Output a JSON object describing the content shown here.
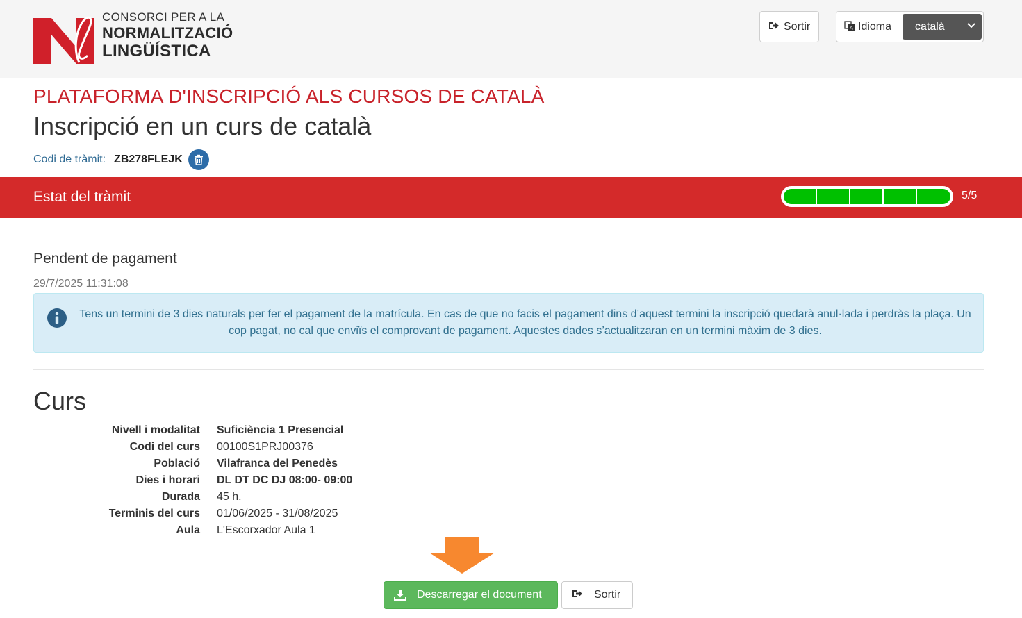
{
  "header": {
    "logo": {
      "line1": "CONSORCI PER A LA",
      "line2": "NORMALITZACIÓ",
      "line3": "LINGÜÍSTICA"
    },
    "sortir_label": "Sortir",
    "language_label": "Idioma",
    "language_selected": "català"
  },
  "titles": {
    "platform": "PLATAFORMA D'INSCRIPCIÓ ALS CURSOS DE CATALÀ",
    "page": "Inscripció en un curs de català"
  },
  "procedure": {
    "code_label": "Codi de tràmit:",
    "code_value": "ZB278FLEJK"
  },
  "status_bar": {
    "title": "Estat del tràmit",
    "progress_text": "5/5",
    "progress_steps_done": 5,
    "progress_steps_total": 5
  },
  "state": {
    "name": "Pendent de pagament",
    "date": "29/7/2025 11:31:08",
    "alert_text": "Tens un termini de 3 dies naturals per fer el pagament de la matrícula. En cas de que no facis el pagament dins d’aquest termini la inscripció quedarà anul·lada i perdràs la plaça. Un cop pagat, no cal que enviïs el comprovant de pagament. Aquestes dades s’actualitzaran en un termini màxim de 3 dies."
  },
  "course": {
    "section_title": "Curs",
    "rows": [
      {
        "label": "Nivell i modalitat",
        "value": "Suficiència 1 Presencial",
        "bold": true
      },
      {
        "label": "Codi del curs",
        "value": "00100S1PRJ00376",
        "bold": false
      },
      {
        "label": "Població",
        "value": "Vilafranca del Penedès",
        "bold": true
      },
      {
        "label": "Dies i horari",
        "value": "DL DT DC DJ 08:00- 09:00",
        "bold": true
      },
      {
        "label": "Durada",
        "value": "45 h.",
        "bold": false
      },
      {
        "label": "Terminis del curs",
        "value": "01/06/2025 - 31/08/2025",
        "bold": false
      },
      {
        "label": "Aula",
        "value": "L'Escorxador Aula 1",
        "bold": false
      }
    ]
  },
  "actions": {
    "download_label": "Descarregar el document",
    "sortir_label": "Sortir"
  },
  "colors": {
    "brand_red": "#c8222a",
    "status_red": "#d42a2a",
    "progress_green": "#00c000",
    "alert_bg": "#d9edf7",
    "button_green": "#5cb85c",
    "arrow_orange": "#f7882f",
    "trash_blue": "#2d6ca8"
  },
  "icons": {
    "sortir": "sign-out-icon",
    "language": "translate-icon",
    "select": "chevron-down-icon",
    "delete": "trash-icon",
    "info": "info-circle-icon",
    "download": "download-icon",
    "pointer": "arrow-down-icon"
  }
}
